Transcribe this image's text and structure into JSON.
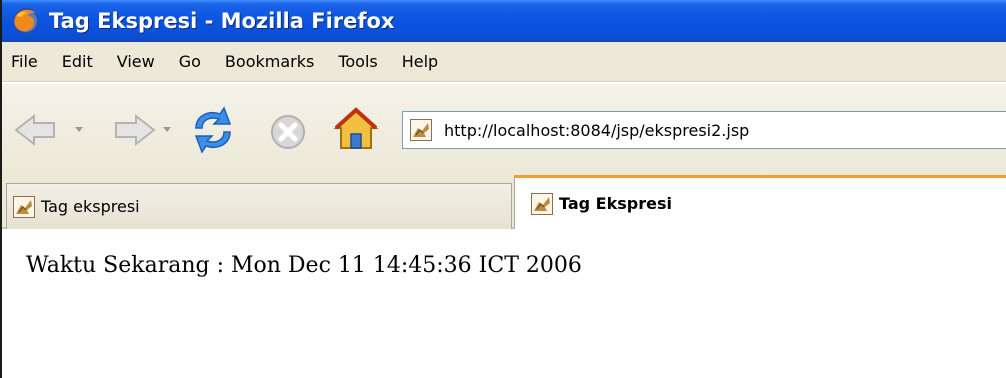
{
  "window": {
    "title": "Tag Ekspresi - Mozilla Firefox",
    "app_icon": "firefox-icon"
  },
  "menubar": {
    "items": [
      "File",
      "Edit",
      "View",
      "Go",
      "Bookmarks",
      "Tools",
      "Help"
    ]
  },
  "toolbar": {
    "buttons": [
      "back-icon",
      "forward-icon",
      "reload-icon",
      "stop-icon",
      "home-icon"
    ]
  },
  "address_bar": {
    "url": "http://localhost:8084/jsp/ekspresi2.jsp",
    "favicon": "page-favicon"
  },
  "tabs": [
    {
      "label": "Tag ekspresi",
      "active": false
    },
    {
      "label": "Tag Ekspresi",
      "active": true
    }
  ],
  "page": {
    "text": "Waktu Sekarang : Mon Dec 11 14:45:36 ICT 2006"
  },
  "colors": {
    "titlebar": "#0a54e0",
    "chrome": "#ece9d8",
    "active_tab_accent": "#f0a030"
  }
}
